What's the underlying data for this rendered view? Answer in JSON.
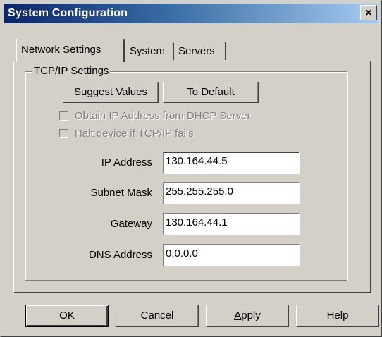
{
  "window": {
    "title": "System Configuration",
    "close_glyph": "×"
  },
  "tabs": [
    {
      "label": "Network Settings",
      "active": true
    },
    {
      "label": "System",
      "active": false
    },
    {
      "label": "Servers",
      "active": false
    }
  ],
  "group": {
    "title": "TCP/IP Settings",
    "suggest_label": "Suggest Values",
    "default_label": "To Default"
  },
  "checks": [
    {
      "label": "Obtain IP Address from DHCP Server",
      "checked": false,
      "enabled": false
    },
    {
      "label": "Halt device if TCP/IP fails",
      "checked": false,
      "enabled": false
    }
  ],
  "fields": [
    {
      "label": "IP Address",
      "value": "130.164.44.5"
    },
    {
      "label": "Subnet Mask",
      "value": "255.255.255.0"
    },
    {
      "label": "Gateway",
      "value": "130.164.44.1"
    },
    {
      "label": "DNS Address",
      "value": "0.0.0.0"
    }
  ],
  "buttons": {
    "ok": "OK",
    "cancel": "Cancel",
    "apply_prefix": "A",
    "apply_rest": "pply",
    "help": "Help"
  }
}
